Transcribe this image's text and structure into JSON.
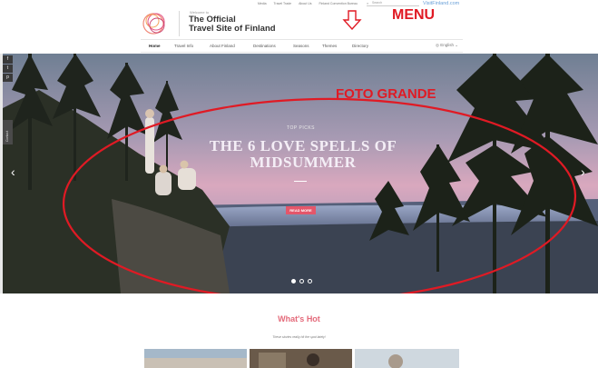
{
  "header": {
    "welcome": "Welcome to",
    "title_line1": "The Official",
    "title_line2": "Travel Site of Finland",
    "top_links": [
      "Media",
      "Travel Trade",
      "About Us",
      "Finland Convention Bureau"
    ],
    "search_placeholder": "Search",
    "visit_link": "VisitFinland.com",
    "language": "English"
  },
  "nav": {
    "items": [
      "Home",
      "Travel Info",
      "About Finland",
      "Destinations",
      "Seasons",
      "Themes",
      "Directory"
    ],
    "active": "Home"
  },
  "annotations": {
    "menu": "MENU",
    "foto": "FOTO GRANDE"
  },
  "hero": {
    "kicker": "TOP PICKS",
    "title": "THE 6 LOVE SPELLS OF MIDSUMMER",
    "cta": "READ MORE",
    "slides": 3,
    "active_slide": 1
  },
  "social": [
    "f",
    "t",
    "p"
  ],
  "side_tab": "Contact",
  "whats_hot": {
    "title": "What's Hot",
    "subtitle": "These stories really hit the spot lately!"
  },
  "colors": {
    "accent": "#e4566a",
    "annotation": "#e01a24",
    "title_text": "#333333"
  }
}
